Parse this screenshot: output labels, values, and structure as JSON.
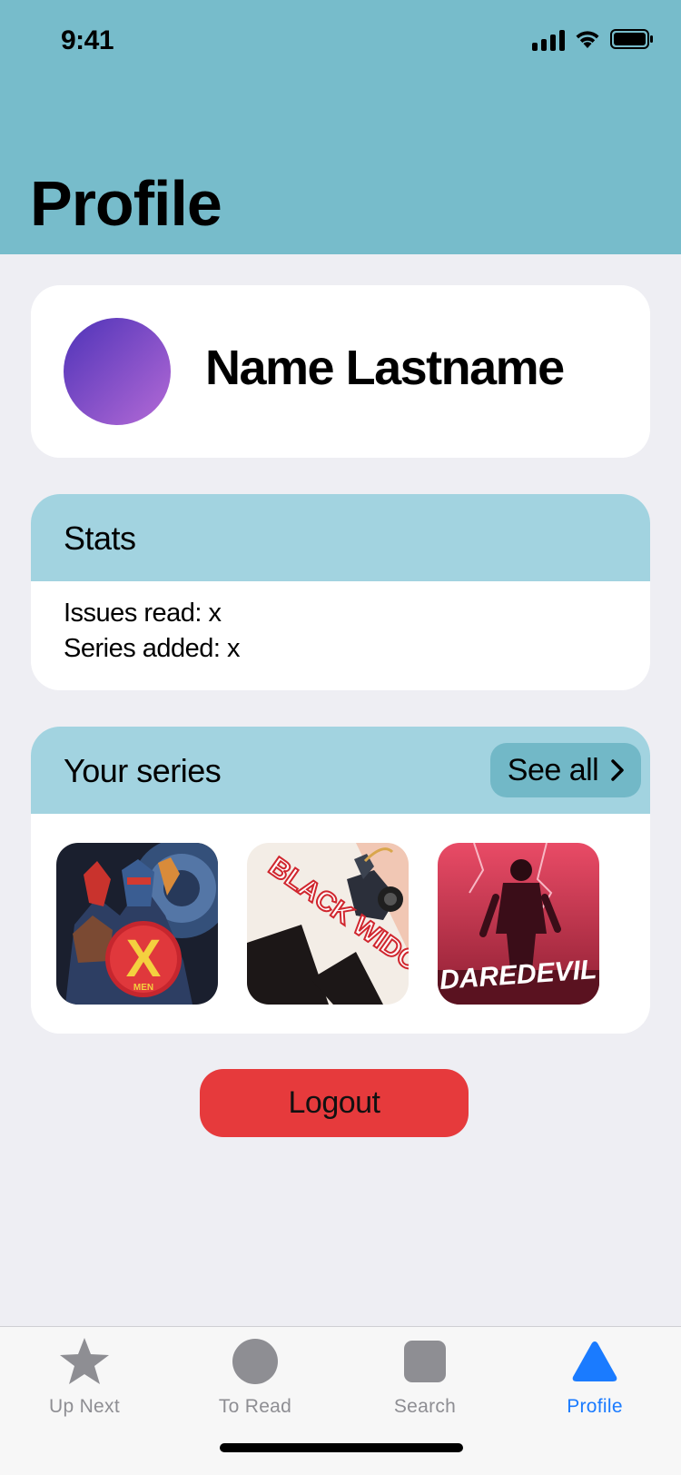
{
  "status_bar": {
    "time": "9:41"
  },
  "header": {
    "title": "Profile"
  },
  "profile": {
    "name": "Name Lastname"
  },
  "stats": {
    "title": "Stats",
    "issues_read": "Issues read: x",
    "series_added": "Series added: x"
  },
  "series": {
    "title": "Your series",
    "see_all_label": "See all",
    "covers": [
      {
        "name": "X-Men",
        "logo_text": "X",
        "sub_text": "MEN"
      },
      {
        "name": "Black Widow",
        "logo_text": "BLACK WIDOW"
      },
      {
        "name": "Daredevil",
        "logo_text": "DAREDEVIL"
      }
    ]
  },
  "logout_label": "Logout",
  "tabs": [
    {
      "label": "Up Next",
      "icon": "star-icon"
    },
    {
      "label": "To Read",
      "icon": "circle-icon"
    },
    {
      "label": "Search",
      "icon": "square-icon"
    },
    {
      "label": "Profile",
      "icon": "triangle-icon",
      "active": true
    }
  ],
  "colors": {
    "header": "#77BCCB",
    "card_header": "#A2D3E0",
    "see_all": "#72B8C7",
    "logout": "#E63A3C",
    "tab_active": "#1A7BFF",
    "tab_inactive": "#8E8E93"
  }
}
